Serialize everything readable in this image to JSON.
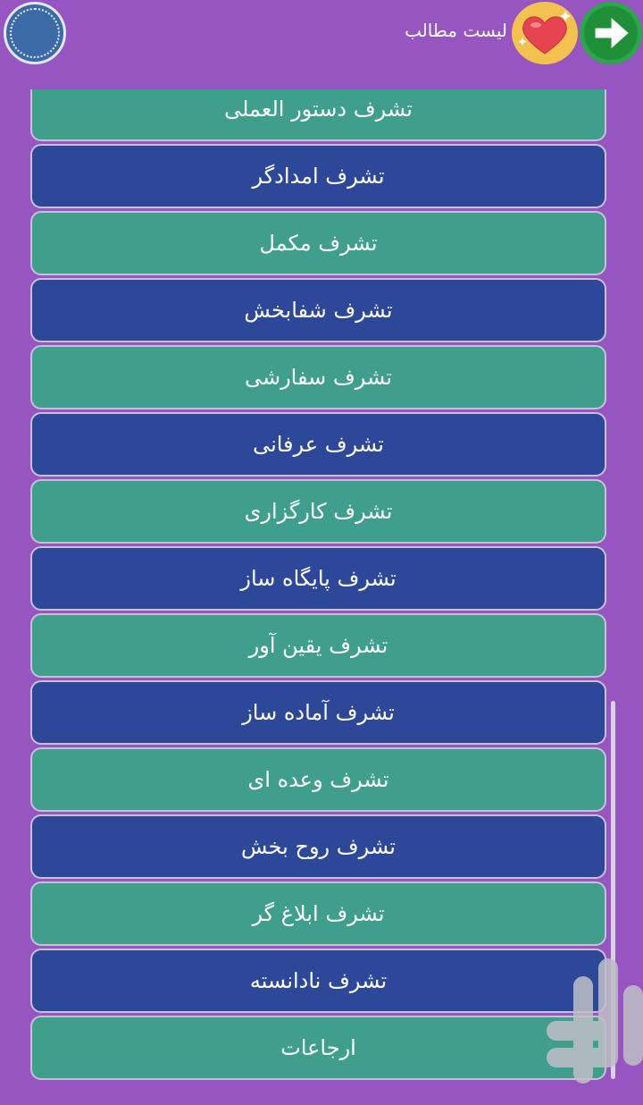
{
  "header": {
    "title": "لیست مطالب",
    "logo_icon": "app-logo-icon",
    "favorite_icon": "heart-icon",
    "back_icon": "arrow-right-icon"
  },
  "list": {
    "items": [
      {
        "label": "تشرف دستور العملی",
        "color": "green"
      },
      {
        "label": "تشرف امدادگر",
        "color": "blue"
      },
      {
        "label": "تشرف مکمل",
        "color": "green"
      },
      {
        "label": "تشرف شفابخش",
        "color": "blue"
      },
      {
        "label": "تشرف سفارشی",
        "color": "green"
      },
      {
        "label": "تشرف عرفانی",
        "color": "blue"
      },
      {
        "label": "تشرف کارگزاری",
        "color": "green"
      },
      {
        "label": "تشرف پایگاه ساز",
        "color": "blue"
      },
      {
        "label": "تشرف یقین آور",
        "color": "green"
      },
      {
        "label": "تشرف آماده ساز",
        "color": "blue"
      },
      {
        "label": "تشرف وعده ای",
        "color": "green"
      },
      {
        "label": "تشرف روح بخش",
        "color": "blue"
      },
      {
        "label": "تشرف ابلاغ گر",
        "color": "green"
      },
      {
        "label": "تشرف نادانسته",
        "color": "blue"
      },
      {
        "label": "ارجاعات",
        "color": "green"
      }
    ]
  },
  "colors": {
    "background": "#9655c0",
    "green_item": "#3f9f8c",
    "blue_item": "#2d4899"
  }
}
